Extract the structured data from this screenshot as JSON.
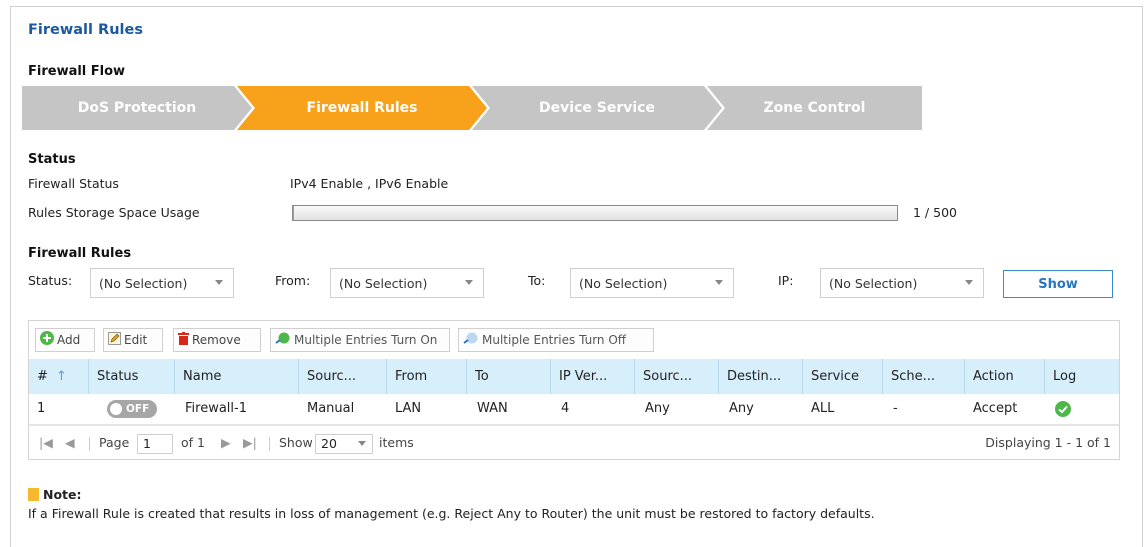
{
  "title": "Firewall Rules",
  "flow": {
    "heading": "Firewall Flow",
    "steps": [
      {
        "label": "DoS Protection",
        "active": false
      },
      {
        "label": "Firewall Rules",
        "active": true
      },
      {
        "label": "Device Service",
        "active": false
      },
      {
        "label": "Zone Control",
        "active": false
      }
    ]
  },
  "status": {
    "heading": "Status",
    "firewall_status_label": "Firewall Status",
    "firewall_status_value": "IPv4 Enable , IPv6 Enable",
    "storage_label": "Rules Storage Space Usage",
    "storage_used": 1,
    "storage_total": 500,
    "storage_text": "1 / 500"
  },
  "rules": {
    "heading": "Firewall Rules",
    "filters": {
      "status_label": "Status:",
      "status_value": "(No Selection)",
      "from_label": "From:",
      "from_value": "(No Selection)",
      "to_label": "To:",
      "to_value": "(No Selection)",
      "ip_label": "IP:",
      "ip_value": "(No Selection)",
      "show_label": "Show"
    },
    "toolbar": {
      "add": "Add",
      "edit": "Edit",
      "remove": "Remove",
      "multi_on": "Multiple Entries Turn On",
      "multi_off": "Multiple Entries Turn Off"
    },
    "columns": [
      "#",
      "Status",
      "Name",
      "Sourc...",
      "From",
      "To",
      "IP Ver...",
      "Sourc...",
      "Destin...",
      "Service",
      "Sche...",
      "Action",
      "Log"
    ],
    "rows": [
      {
        "num": "1",
        "status": "OFF",
        "name": "Firewall-1",
        "source_type": "Manual",
        "from": "LAN",
        "to": "WAN",
        "ip_version": "4",
        "source": "Any",
        "destination": "Any",
        "service": "ALL",
        "schedule": "-",
        "action": "Accept",
        "log_icon": "check-circle-icon"
      }
    ],
    "pager": {
      "page_label": "Page",
      "page_value": "1",
      "of_label": "of 1",
      "show_label": "Show",
      "per_page": "20",
      "items_label": "items",
      "displaying": "Displaying 1 - 1 of 1"
    }
  },
  "note": {
    "title": "Note:",
    "text": "If a Firewall Rule is created that results in loss of management (e.g. Reject Any to Router) the unit must be restored to factory defaults."
  },
  "colors": {
    "title_blue": "#1a5aa0",
    "flow_active": "#f8a11a",
    "flow_inactive": "#c5c5c5",
    "header_bg": "#d7eefb",
    "log_green": "#4db848"
  }
}
